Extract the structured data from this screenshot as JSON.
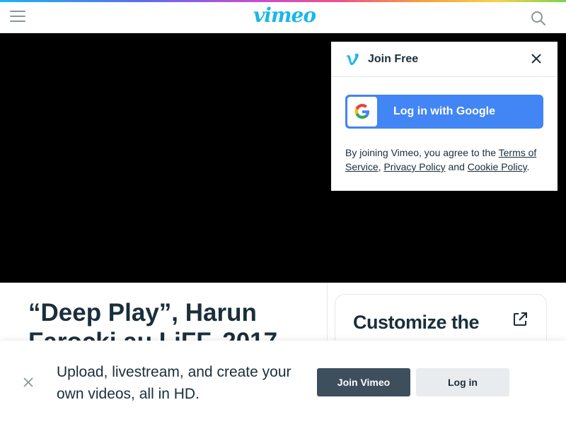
{
  "header": {
    "logo_text": "vimeo",
    "menu_icon": "hamburger-icon",
    "search_icon": "search-icon",
    "brand_color": "#1ab7ea"
  },
  "join_popup": {
    "title": "Join Free",
    "google_button_label": "Log in with Google",
    "terms_prefix": "By joining Vimeo, you agree to the ",
    "terms_of_service": "Terms of Service",
    "comma": ", ",
    "privacy_policy": "Privacy Policy",
    "and": " and ",
    "cookie_policy": "Cookie Policy",
    "period": ".",
    "google_button_color": "#4285f4"
  },
  "video": {
    "title": "“Deep Play”, Harun Farocki au LiFF, 2017"
  },
  "side_card": {
    "title": "Customize the",
    "icon": "external-link-icon"
  },
  "signup_banner": {
    "message": "Upload, livestream, and create your own videos, all in HD.",
    "join_label": "Join Vimeo",
    "login_label": "Log in"
  }
}
